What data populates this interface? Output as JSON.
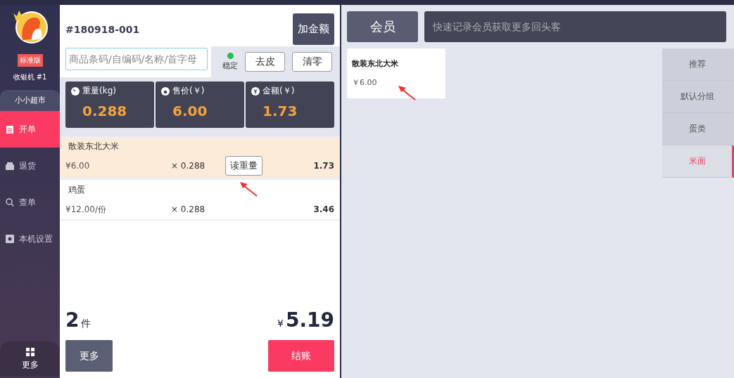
{
  "sidebar": {
    "edition_badge": "标准版",
    "register": "收银机 #1",
    "store_tab": "小小超市",
    "items": [
      {
        "kind": "order",
        "label": "开单",
        "selected": true
      },
      {
        "kind": "return",
        "label": "退货",
        "selected": false
      },
      {
        "kind": "search",
        "label": "查单",
        "selected": false
      },
      {
        "kind": "settings",
        "label": "本机设置",
        "selected": false
      }
    ],
    "more": "更多"
  },
  "order": {
    "number": "#180918-001",
    "add_amount_button": "加金额",
    "search_placeholder": "商品条码/自编码/名称/首字母",
    "scale": {
      "stable": true,
      "stable_label": "稳定",
      "buttons": [
        "去皮",
        "清零"
      ]
    },
    "readings": [
      {
        "kind": "weight",
        "label": "重量(kg)",
        "value": "0.288"
      },
      {
        "kind": "price",
        "label": "售价(￥)",
        "value": "6.00"
      },
      {
        "kind": "amount",
        "label": "金额(￥)",
        "value": "1.73"
      }
    ],
    "items": [
      {
        "name": "散装东北大米",
        "price": "¥6.00",
        "quantity": "× 0.288",
        "action": "读重量",
        "amount": "1.73",
        "selected": true
      },
      {
        "name": "鸡蛋",
        "price": "¥12.00/份",
        "quantity": "× 0.288",
        "amount": "3.46",
        "selected": false
      }
    ],
    "count": "2",
    "count_unit": "件",
    "currency": "¥",
    "total": "5.19",
    "buttons": [
      {
        "kind": "secondary",
        "label": "更多"
      },
      {
        "kind": "primary",
        "label": "结账"
      }
    ]
  },
  "catalog": {
    "member_button": "会员",
    "member_placeholder": "快速记录会员获取更多回头客",
    "products": [
      {
        "name": "散装东北大米",
        "price": "￥6.00"
      }
    ],
    "categories": [
      {
        "label": "推荐",
        "selected": false
      },
      {
        "label": "默认分组",
        "selected": false
      },
      {
        "label": "蛋类",
        "selected": false
      },
      {
        "label": "米面",
        "selected": true
      }
    ]
  }
}
